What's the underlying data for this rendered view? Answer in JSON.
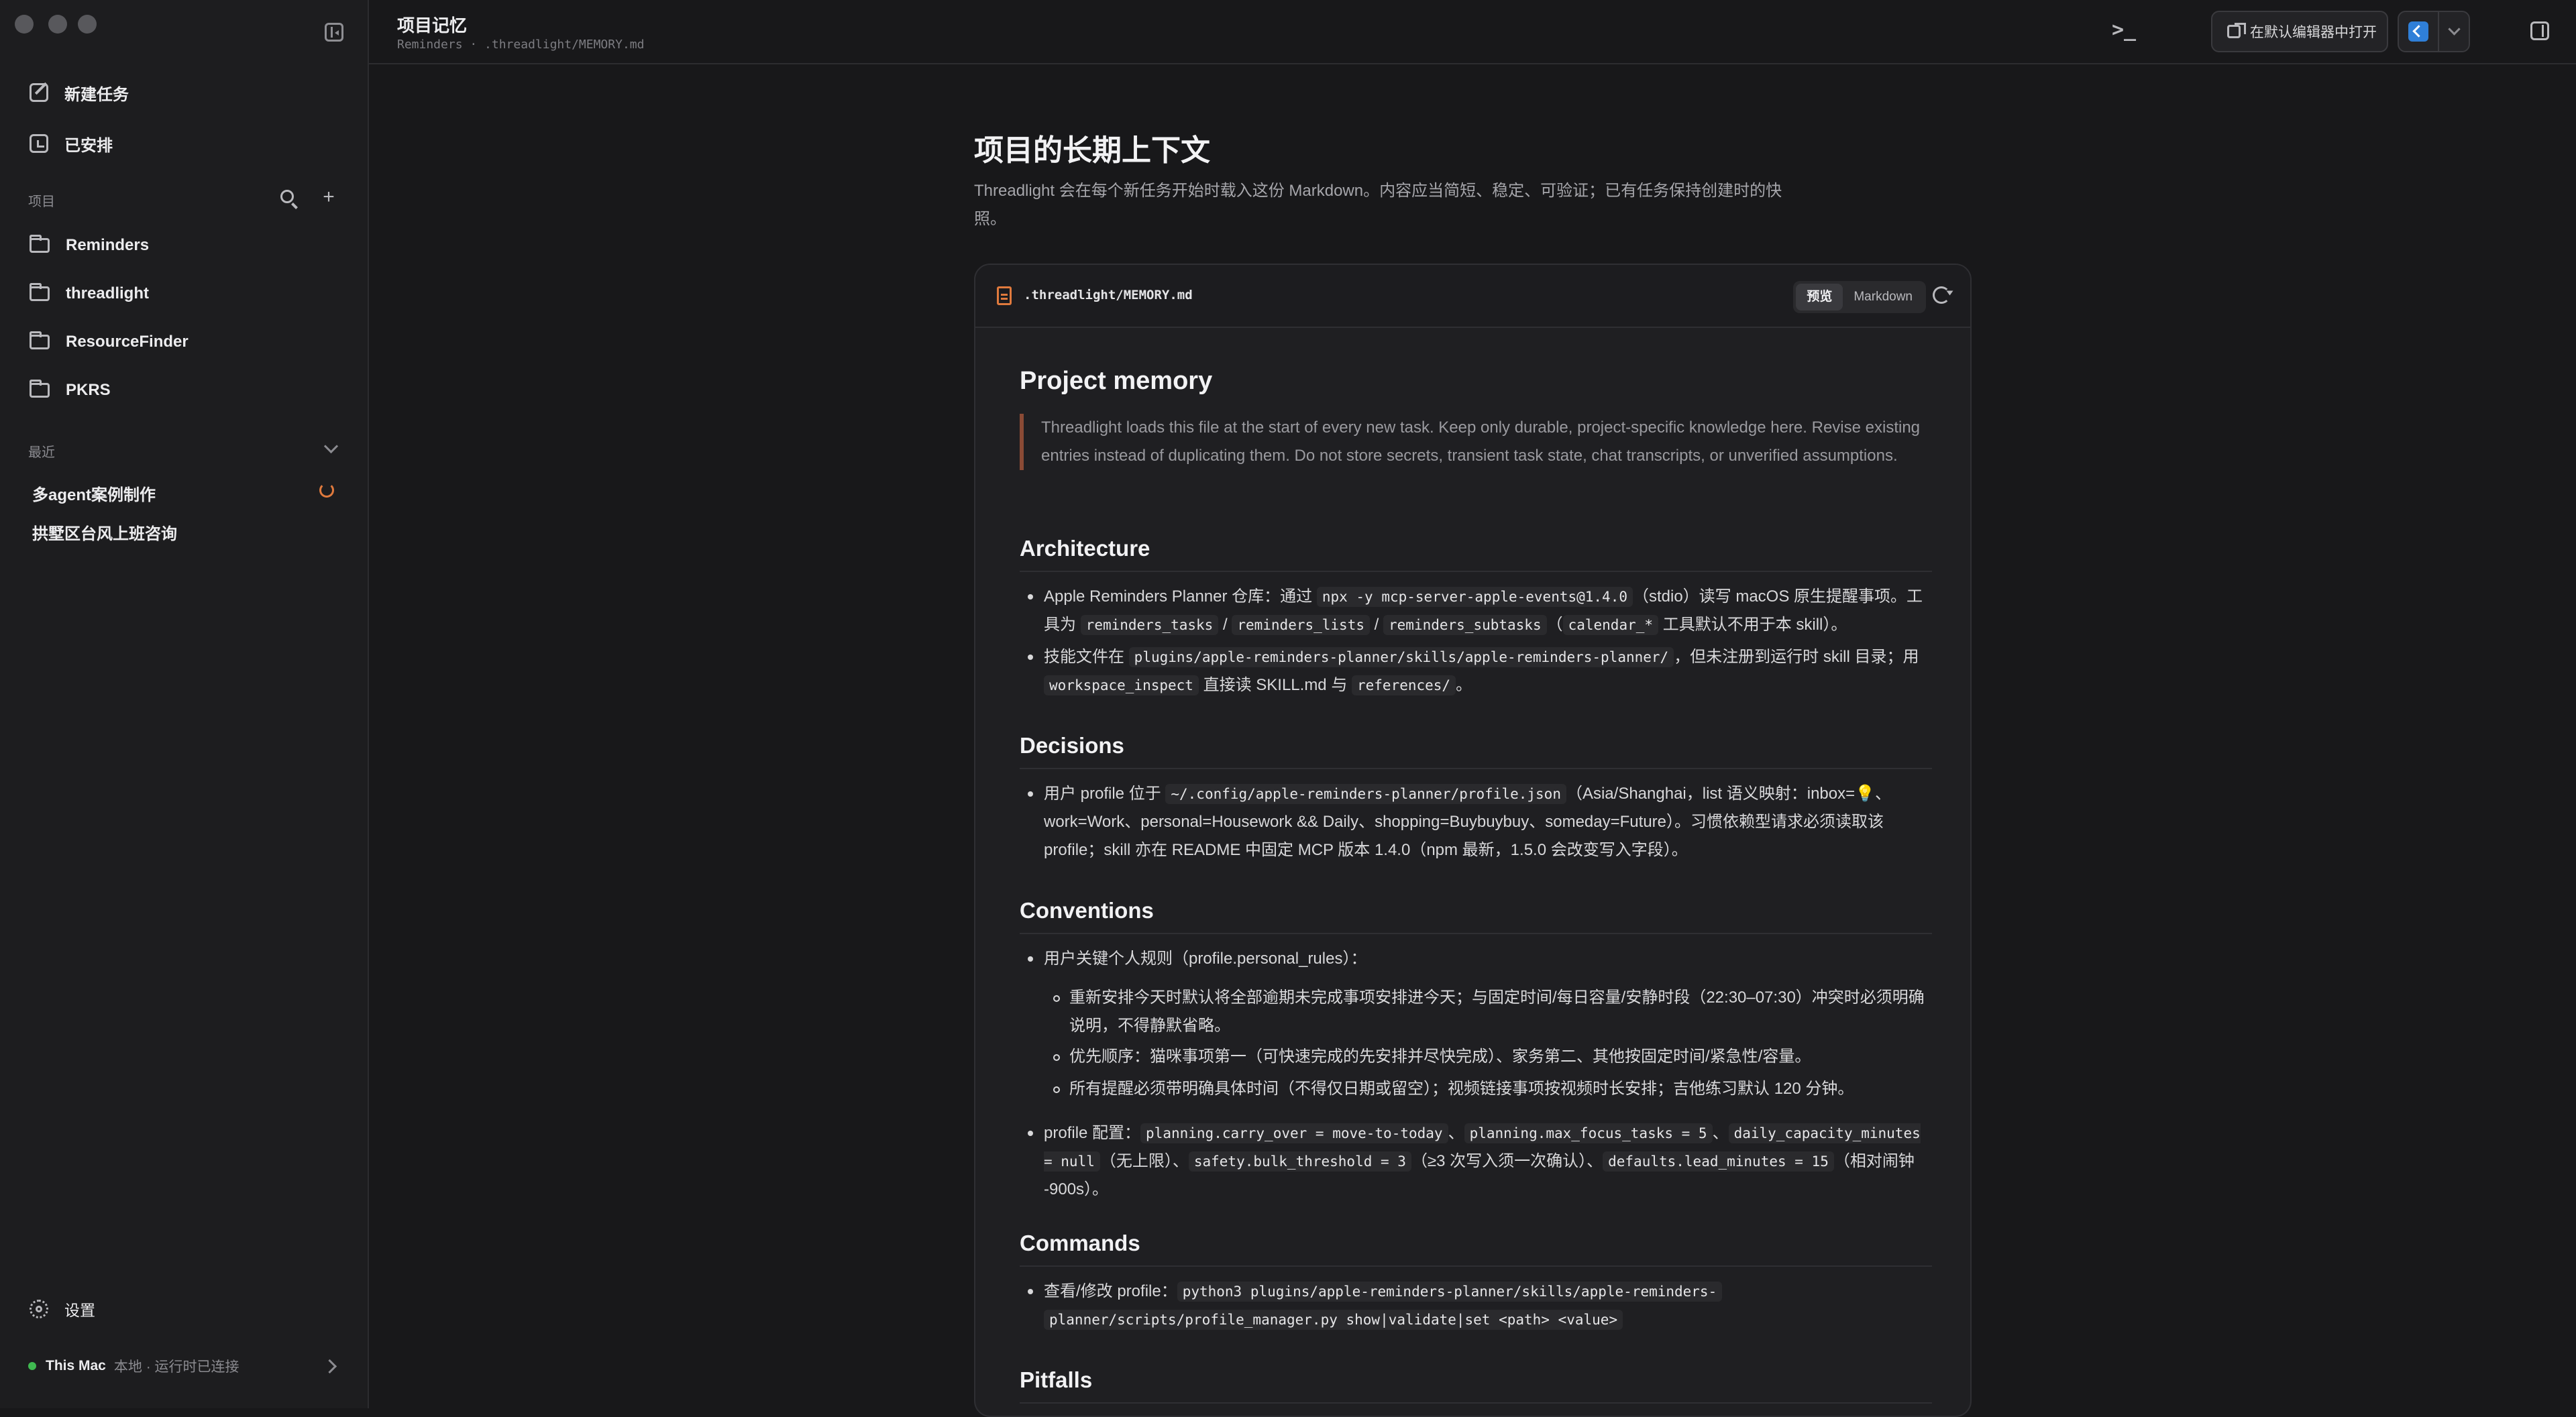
{
  "sidebar": {
    "new_task": "新建任务",
    "scheduled": "已安排",
    "projects_label": "项目",
    "projects": [
      "Reminders",
      "threadlight",
      "ResourceFinder",
      "PKRS"
    ],
    "recent_label": "最近",
    "recent": [
      "多agent案例制作",
      "拱墅区台风上班咨询"
    ],
    "settings": "设置",
    "machine_name": "This Mac",
    "machine_status": "本地 · 运行时已连接"
  },
  "header": {
    "title": "项目记忆",
    "subtitle": "Reminders · .threadlight/MEMORY.md",
    "open_editor": "在默认编辑器中打开"
  },
  "main": {
    "heading": "项目的长期上下文",
    "description": "Threadlight 会在每个新任务开始时载入这份 Markdown。内容应当简短、稳定、可验证；已有任务保持创建时的快照。"
  },
  "card": {
    "path": ".threadlight/MEMORY.md",
    "tab_preview": "预览",
    "tab_markdown": "Markdown",
    "doc": {
      "h1": "Project memory",
      "quote": "Threadlight loads this file at the start of every new task. Keep only durable, project-specific knowledge here. Revise existing entries instead of duplicating them. Do not store secrets, transient task state, chat transcripts, or unverified assumptions.",
      "architecture": "Architecture",
      "arch1": {
        "t1": "Apple Reminders Planner 仓库：通过 ",
        "c1": "npx -y mcp-server-apple-events@1.4.0",
        "t2": "（stdio）读写 macOS 原生提醒事项。工具为 ",
        "c2": "reminders_tasks",
        "t3": " / ",
        "c3": "reminders_lists",
        "t4": " / ",
        "c4": "reminders_subtasks",
        "t5": "（",
        "c5": "calendar_*",
        "t6": " 工具默认不用于本 skill）。"
      },
      "arch2": {
        "t1": "技能文件在 ",
        "c1": "plugins/apple-reminders-planner/skills/apple-reminders-planner/",
        "t2": "，但未注册到运行时 skill 目录；用 ",
        "c2": "workspace_inspect",
        "t3": " 直接读 SKILL.md 与 ",
        "c3": "references/",
        "t4": "。"
      },
      "decisions": "Decisions",
      "dec1": {
        "t1": "用户 profile 位于 ",
        "c1": "~/.config/apple-reminders-planner/profile.json",
        "t2": "（Asia/Shanghai，list 语义映射：inbox=💡、work=Work、personal=Housework && Daily、shopping=Buybuybuy、someday=Future）。习惯依赖型请求必须读取该 profile；skill 亦在 README 中固定 MCP 版本 1.4.0（npm 最新，1.5.0 会改变写入字段）。"
      },
      "conventions": "Conventions",
      "conv1": "用户关键个人规则（profile.personal_rules）：",
      "conv1_sub": [
        "重新安排今天时默认将全部逾期未完成事项安排进今天；与固定时间/每日容量/安静时段（22:30–07:30）冲突时必须明确说明，不得静默省略。",
        "优先顺序：猫咪事项第一（可快速完成的先安排并尽快完成）、家务第二、其他按固定时间/紧急性/容量。",
        "所有提醒必须带明确具体时间（不得仅日期或留空）；视频链接事项按视频时长安排；吉他练习默认 120 分钟。"
      ],
      "conv2": {
        "t1": "profile 配置：",
        "c1": "planning.carry_over = move-to-today",
        "t2": "、",
        "c2": "planning.max_focus_tasks = 5",
        "t3": "、",
        "c3": "daily_capacity_minutes = null",
        "t4": "（无上限）、",
        "c4": "safety.bulk_threshold = 3",
        "t5": "（≥3 次写入须一次确认）、",
        "c5": "defaults.lead_minutes = 15",
        "t6": "（相对闹钟 -900s）。"
      },
      "commands": "Commands",
      "cmd1": {
        "t1": "查看/修改 profile：",
        "c1a": "python3 plugins/apple-reminders-planner/skills/apple-reminders-",
        "c1b": "planner/scripts/profile_manager.py show|validate|set <path> <value>"
      },
      "pitfalls": "Pitfalls"
    }
  },
  "colors": {
    "accent": "#e07a3d",
    "online": "#3fb950",
    "background": "#18181a",
    "sidebar": "#1d1d1f"
  },
  "icons": [
    "sidebar-toggle-icon",
    "edit-icon",
    "calendar-clock-icon",
    "search-icon",
    "plus-icon",
    "folder-icon",
    "spinner-icon",
    "gear-icon",
    "external-open-icon",
    "vscode-icon",
    "terminal-icon",
    "panel-icon",
    "file-icon",
    "refresh-icon"
  ]
}
